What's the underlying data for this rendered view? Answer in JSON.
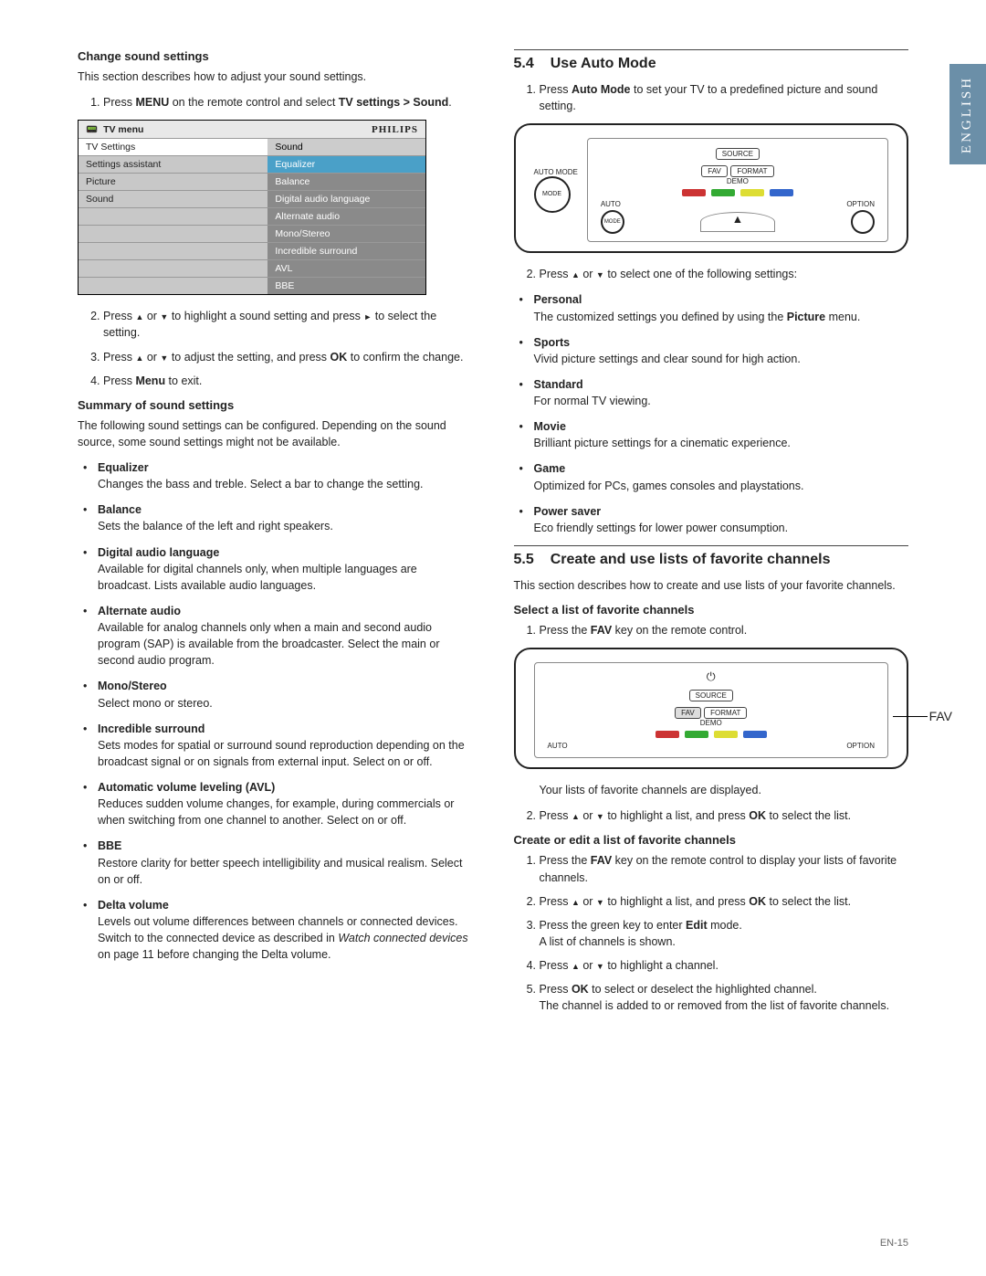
{
  "tab": "ENGLISH",
  "left": {
    "h1": "Change sound settings",
    "intro": "This section describes how to adjust your sound settings.",
    "step1_a": "Press ",
    "step1_menu": "MENU",
    "step1_b": " on the remote control and select ",
    "step1_tvset": "TV settings > Sound",
    "step1_c": ".",
    "menu": {
      "title": "TV menu",
      "brand": "PHILIPS",
      "l1": "TV Settings",
      "r1": "Sound",
      "l2": "Settings assistant",
      "r2": "Equalizer",
      "l3": "Picture",
      "r3": "Balance",
      "l4": "Sound",
      "r4": "Digital audio language",
      "r5": "Alternate audio",
      "r6": "Mono/Stereo",
      "r7": "Incredible surround",
      "r8": "AVL",
      "r9": "BBE"
    },
    "step2_a": "Press ",
    "step2_b": " or ",
    "step2_c": " to highlight a sound setting and press ",
    "step2_d": " to select the setting.",
    "step3_a": "Press ",
    "step3_b": " or ",
    "step3_c": " to adjust the setting, and press ",
    "step3_ok": "OK",
    "step3_d": " to confirm the change.",
    "step4_a": "Press ",
    "step4_menu": "Menu",
    "step4_b": " to exit.",
    "h2": "Summary of sound settings",
    "summary_intro": "The following sound settings can be configured. Depending on the sound source, some sound settings might not be available.",
    "items": {
      "eq_t": "Equalizer",
      "eq_d": "Changes the bass and treble.  Select a bar to change the setting.",
      "bal_t": "Balance",
      "bal_d": "Sets the balance of the left and right speakers.",
      "dal_t": "Digital audio language",
      "dal_d": "Available for digital channels only, when multiple languages are broadcast. Lists available audio languages.",
      "alt_t": "Alternate audio",
      "alt_d": "Available for analog channels only when a main and second audio program (SAP) is available from the broadcaster. Select the main or second audio program.",
      "ms_t": "Mono/Stereo",
      "ms_d": "Select mono or stereo.",
      "inc_t": "Incredible surround",
      "inc_d": "Sets modes for spatial or surround sound reproduction depending on the broadcast signal or on signals from external input.  Select on or off.",
      "avl_t": "Automatic volume leveling (AVL)",
      "avl_d": "Reduces sudden volume changes, for example, during commercials or when switching from one channel to another. Select on or off.",
      "bbe_t": "BBE",
      "bbe_d": "Restore clarity for better speech intelligibility and musical realism. Select on or off.",
      "dv_t": "Delta volume",
      "dv_d1": "Levels out volume differences between channels or connected devices.  Switch to the connected device as described in ",
      "dv_i": "Watch connected devices",
      "dv_d2": " on page 11 before changing the Delta volume."
    }
  },
  "right": {
    "s54_num": "5.4",
    "s54_t": "Use Auto Mode",
    "s54_1a": "Press ",
    "s54_1b": "Auto Mode",
    "s54_1c": " to set your TV to a predefined picture and sound setting.",
    "remote1": {
      "source": "SOURCE",
      "fav": "FAV",
      "format": "FORMAT",
      "demo": "DEMO",
      "auto": "AUTO",
      "option": "OPTION",
      "automode_lbl": "AUTO MODE",
      "mode": "MODE"
    },
    "s54_2a": "Press ",
    "s54_2b": " or ",
    "s54_2c": " to select one of the following settings:",
    "modes": {
      "per_t": "Personal",
      "per_d1": "The customized settings you defined by using the ",
      "per_b": "Picture",
      "per_d2": " menu.",
      "spo_t": "Sports",
      "spo_d": "Vivid picture settings and clear sound for high action.",
      "std_t": "Standard",
      "std_d": "For normal TV viewing.",
      "mov_t": "Movie",
      "mov_d": "Brilliant picture settings for a cinematic experience.",
      "gam_t": "Game",
      "gam_d": "Optimized for PCs, games consoles and playstations.",
      "pow_t": "Power saver",
      "pow_d": "Eco friendly settings for lower power consumption."
    },
    "s55_num": "5.5",
    "s55_t": "Create and use lists of favorite channels",
    "s55_intro": "This section describes how to create and use lists of your favorite channels.",
    "s55_h1": "Select a list of favorite channels",
    "s55_1a": "Press the ",
    "s55_1b": "FAV",
    "s55_1c": " key on the remote control.",
    "remote2": {
      "source": "SOURCE",
      "fav": "FAV",
      "format": "FORMAT",
      "demo": "DEMO",
      "auto": "AUTO",
      "option": "OPTION",
      "callout": "FAV"
    },
    "s55_after": "Your lists of favorite channels are displayed.",
    "s55_2a": "Press ",
    "s55_2b": " or ",
    "s55_2c": " to highlight a list, and press ",
    "s55_ok": "OK",
    "s55_2d": " to select the list.",
    "s55_h2": "Create or edit a list of favorite channels",
    "c1a": "Press the ",
    "c1b": "FAV",
    "c1c": " key on the remote control to display your lists of favorite channels.",
    "c2a": "Press ",
    "c2b": " or ",
    "c2c": " to highlight a list, and press ",
    "c2ok": "OK",
    "c2d": " to select the list.",
    "c3a": "Press the green key to enter ",
    "c3b": "Edit",
    "c3c": " mode.",
    "c3d": "A list of channels is shown.",
    "c4a": "Press ",
    "c4b": " or ",
    "c4c": " to highlight a channel.",
    "c5a": "Press ",
    "c5ok": "OK",
    "c5b": " to select or deselect the highlighted channel.",
    "c5c": "The channel is added to or removed from the list of favorite channels."
  },
  "pageno": "EN-15"
}
